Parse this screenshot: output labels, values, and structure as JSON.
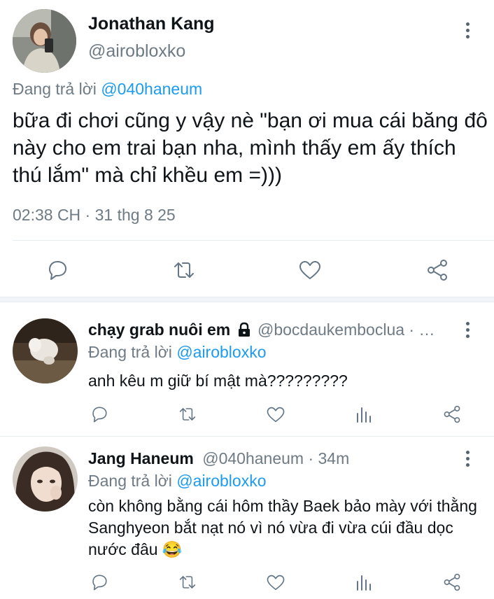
{
  "main_tweet": {
    "author_name": "Jonathan Kang",
    "author_handle": "@airobloxko",
    "replying_label": "Đang trả lời",
    "replying_to": "@040haneum",
    "text": "bữa đi chơi cũng y vậy nè \"bạn ơi mua cái băng đô này cho em trai bạn nha, mình thấy em ấy thích thú lắm\" mà chỉ khều em =)))",
    "timestamp": "02:38 CH · 31 thg 8 25"
  },
  "replies": [
    {
      "author_name": "chạy grab nuôi em",
      "protected": true,
      "handle_time": "@bocdaukemboclua · …",
      "replying_label": "Đang trả lời",
      "replying_to": "@airobloxko",
      "text": "anh kêu m giữ bí mật mà?????????"
    },
    {
      "author_name": "Jang Haneum",
      "handle_time": "@040haneum · 34m",
      "replying_label": "Đang trả lời",
      "replying_to": "@airobloxko",
      "text": "còn không bằng cái hôm thầy Baek bảo mày với thằng Sanghyeon bắt nạt nó vì nó vừa đi vừa cúi đầu dọc nước đâu 😂"
    }
  ],
  "icons": [
    "reply-icon",
    "retweet-icon",
    "like-icon",
    "analytics-icon",
    "share-icon",
    "more-icon",
    "lock-icon"
  ],
  "colors": {
    "accent": "#1d9bf0",
    "secondary_text": "#6e7b85",
    "icon": "#657786",
    "divider": "#e6ecf0"
  }
}
